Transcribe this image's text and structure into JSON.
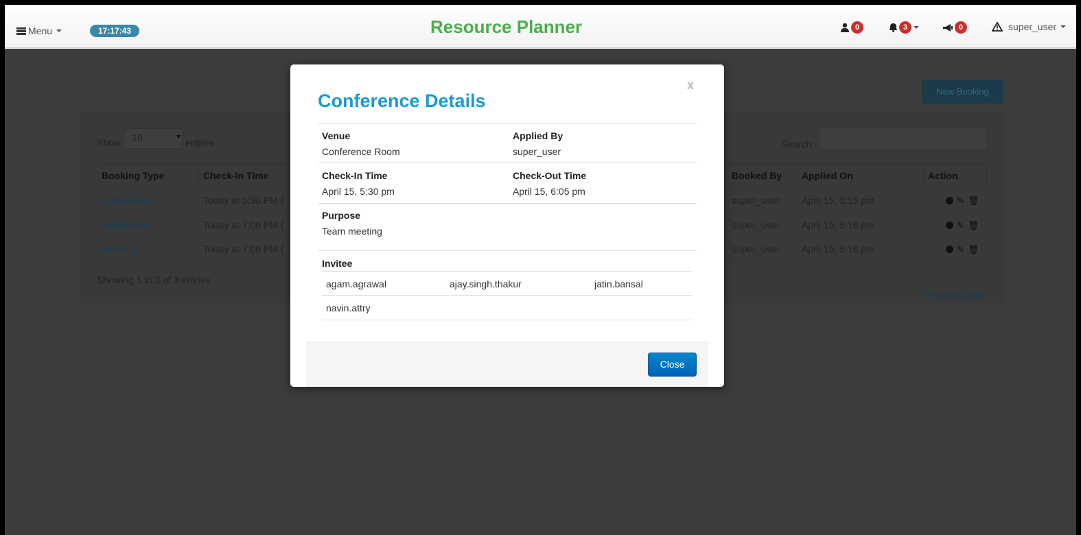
{
  "navbar": {
    "menu_label": "Menu",
    "clock": "17:17:43",
    "brand": "Resource Planner",
    "user_count": "0",
    "notification_count": "3",
    "announcement_count": "0",
    "user_label": "super_user"
  },
  "toolbar": {
    "new_booking_label": "New Booking"
  },
  "table_controls": {
    "show_label": "Show",
    "entries_value": "10",
    "entries_label": "entries",
    "search_label": "Search:",
    "showing_text": "Showing 1 to 3 of 3 entries",
    "previous_label": "Previous",
    "next_label": "Next"
  },
  "table": {
    "headers": {
      "booking_type": "Booking Type",
      "check_in": "Check-In Time",
      "booked_by": "Booked By",
      "applied_on": "Applied On",
      "action": "Action"
    },
    "rows": [
      {
        "booking_type": "conference",
        "check_in": "Today at 5:30 PM (",
        "booked_by": "super_user",
        "applied_on": "April 15, 5:15 pm"
      },
      {
        "booking_type": "conference",
        "check_in": "Today at 7:00 PM (",
        "booked_by": "super_user",
        "applied_on": "April 15, 5:16 pm"
      },
      {
        "booking_type": "meeting",
        "check_in": "Today at 7:00 PM (",
        "booked_by": "super_user",
        "applied_on": "April 15, 5:16 pm"
      }
    ]
  },
  "modal": {
    "close_x": "x",
    "title": "Conference Details",
    "venue_label": "Venue",
    "venue_value": "Conference Room",
    "applied_by_label": "Applied By",
    "applied_by_value": "super_user",
    "check_in_label": "Check-In Time",
    "check_in_value": "April 15, 5:30 pm",
    "check_out_label": "Check-Out Time",
    "check_out_value": "April 15, 6:05 pm",
    "purpose_label": "Purpose",
    "purpose_value": "Team meeting",
    "invitee_label": "Invitee",
    "invitees": [
      "agam.agrawal",
      "ajay.singh.thakur",
      "jatin.bansal",
      "navin.attry"
    ],
    "close_button": "Close"
  }
}
